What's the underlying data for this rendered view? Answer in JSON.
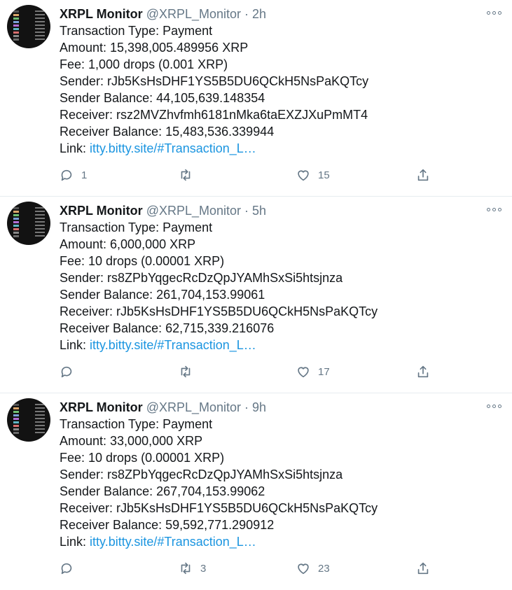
{
  "colors": {
    "link": "#1b95e0",
    "muted": "#657786",
    "text": "#14171a"
  },
  "tweets": [
    {
      "name": "XRPL Monitor",
      "handle": "@XRPL_Monitor",
      "separator": "·",
      "time": "2h",
      "lines": [
        "Transaction Type: Payment",
        "Amount: 15,398,005.489956 XRP",
        "Fee: 1,000 drops (0.001 XRP)",
        "Sender: rJb5KsHsDHF1YS5B5DU6QCkH5NsPaKQTcy",
        "Sender Balance: 44,105,639.148354",
        "Receiver: rsz2MVZhvfmh6181nMka6taEXZJXuPmMT4",
        "Receiver Balance: 15,483,536.339944"
      ],
      "link_label": "Link: ",
      "link_text": "itty.bitty.site/#Transaction_L…",
      "reply_count": "1",
      "retweet_count": "",
      "like_count": "15"
    },
    {
      "name": "XRPL Monitor",
      "handle": "@XRPL_Monitor",
      "separator": "·",
      "time": "5h",
      "lines": [
        "Transaction Type: Payment",
        "Amount: 6,000,000 XRP",
        "Fee: 10 drops (0.00001 XRP)",
        "Sender: rs8ZPbYqgecRcDzQpJYAMhSxSi5htsjnza",
        "Sender Balance: 261,704,153.99061",
        "Receiver: rJb5KsHsDHF1YS5B5DU6QCkH5NsPaKQTcy",
        "Receiver Balance: 62,715,339.216076"
      ],
      "link_label": "Link: ",
      "link_text": "itty.bitty.site/#Transaction_L…",
      "reply_count": "",
      "retweet_count": "",
      "like_count": "17"
    },
    {
      "name": "XRPL Monitor",
      "handle": "@XRPL_Monitor",
      "separator": "·",
      "time": "9h",
      "lines": [
        "Transaction Type: Payment",
        "Amount: 33,000,000 XRP",
        "Fee: 10 drops (0.00001 XRP)",
        "Sender: rs8ZPbYqgecRcDzQpJYAMhSxSi5htsjnza",
        "Sender Balance: 267,704,153.99062",
        "Receiver: rJb5KsHsDHF1YS5B5DU6QCkH5NsPaKQTcy",
        "Receiver Balance: 59,592,771.290912"
      ],
      "link_label": "Link: ",
      "link_text": "itty.bitty.site/#Transaction_L…",
      "reply_count": "",
      "retweet_count": "3",
      "like_count": "23"
    }
  ]
}
